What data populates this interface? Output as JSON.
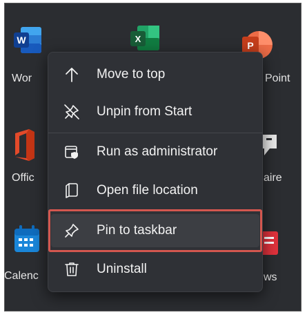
{
  "apps": {
    "word": {
      "label": "Wor",
      "letter": "W"
    },
    "excel": {
      "letter": "X"
    },
    "powerpoint": {
      "label": "Point",
      "letter": "P"
    },
    "office": {
      "label": "Offic"
    },
    "feedback": {
      "label": "aire"
    },
    "calendar": {
      "label": "Calenc"
    },
    "news": {
      "label": "ws"
    }
  },
  "context_menu": {
    "items": [
      {
        "label": "Move to top",
        "icon": "arrow-up-icon"
      },
      {
        "label": "Unpin from Start",
        "icon": "unpin-icon"
      },
      {
        "label": "Run as administrator",
        "icon": "shield-icon"
      },
      {
        "label": "Open file location",
        "icon": "file-location-icon"
      },
      {
        "label": "Pin to taskbar",
        "icon": "pin-icon",
        "highlighted": true
      },
      {
        "label": "Uninstall",
        "icon": "trash-icon"
      }
    ]
  },
  "colors": {
    "highlight_border": "#d4574f",
    "word": "#2b5fbf",
    "excel": "#1f8a4c",
    "powerpoint": "#d9532c",
    "office": "#e34a2a"
  }
}
